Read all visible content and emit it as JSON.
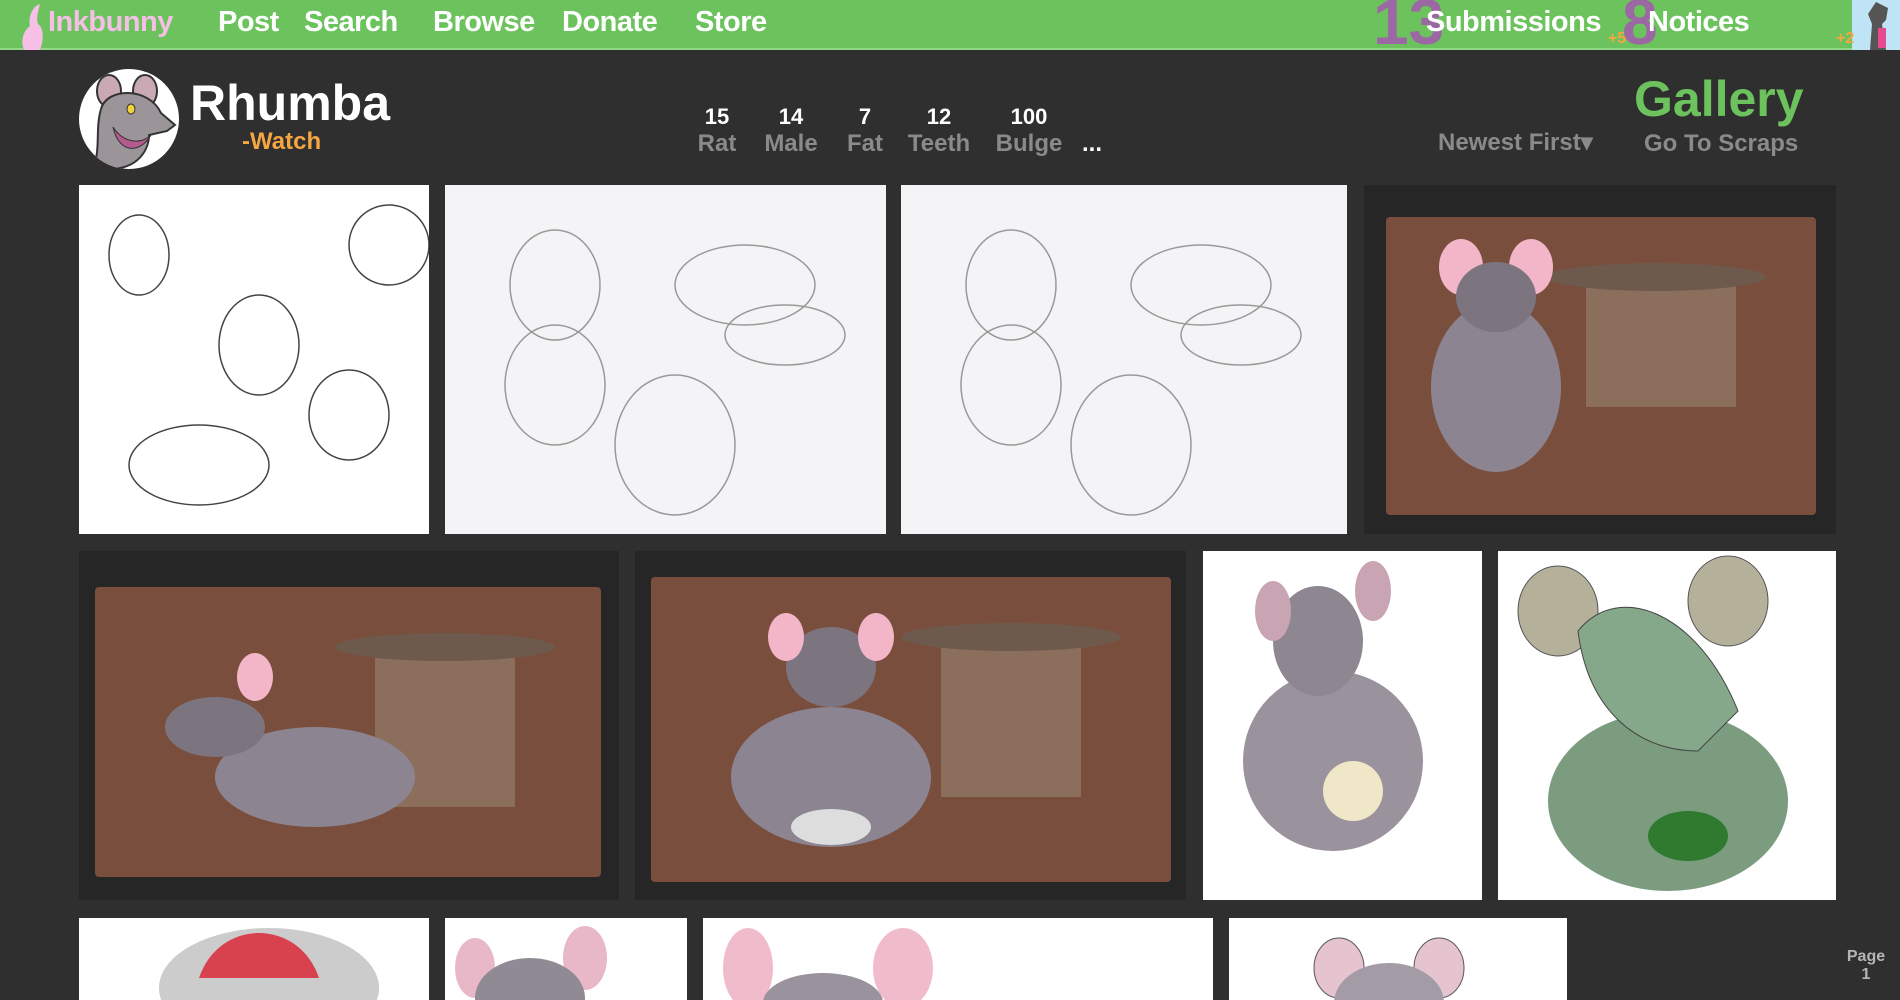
{
  "topbar": {
    "logo": "Inkbunny",
    "nav": [
      "Post",
      "Search",
      "Browse",
      "Donate",
      "Store"
    ],
    "submissions": {
      "count": "13",
      "label": "Submissions"
    },
    "notices": {
      "count": "8",
      "label": "Notices",
      "plus": "+5"
    },
    "user_plus": "+2"
  },
  "profile": {
    "name": "Rhumba",
    "watch": "-Watch"
  },
  "tags": [
    {
      "count": "15",
      "label": "Rat"
    },
    {
      "count": "14",
      "label": "Male"
    },
    {
      "count": "7",
      "label": "Fat"
    },
    {
      "count": "12",
      "label": "Teeth"
    },
    {
      "count": "100",
      "label": "Bulge"
    }
  ],
  "tags_more": "...",
  "gallery": {
    "title": "Gallery",
    "sort": "Newest First▾",
    "scraps": "Go To Scraps"
  },
  "pagination": {
    "label": "Page",
    "number": "1"
  },
  "colors": {
    "brand": "#6cc35e",
    "accent": "#f5a642",
    "count": "#9b68a3"
  }
}
